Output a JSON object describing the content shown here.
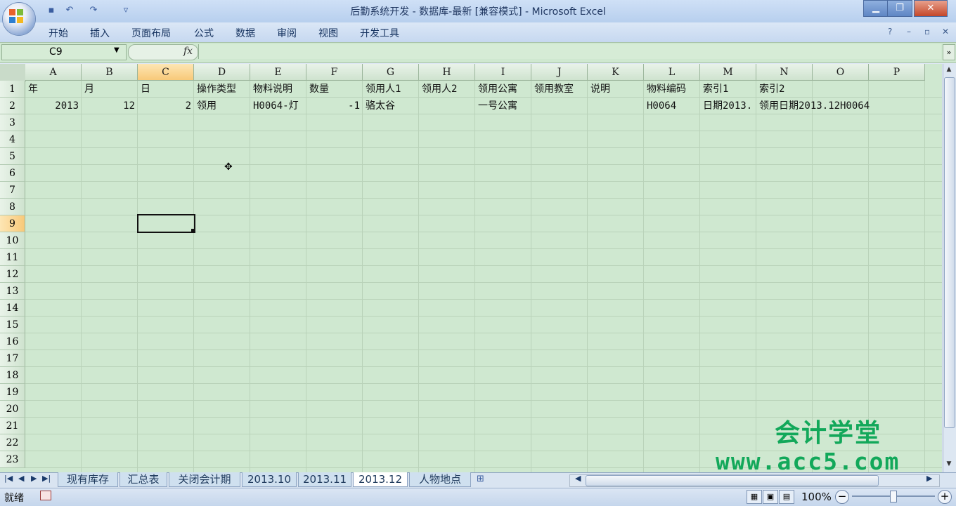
{
  "window": {
    "title": "后勤系统开发 - 数据库-最新  [兼容模式] - Microsoft Excel",
    "minimize": "▁",
    "maximize": "❐",
    "close": "✕"
  },
  "quick_access": [
    "save-icon",
    "undo-icon",
    "redo-icon",
    "customize-icon"
  ],
  "ribbon": {
    "tabs": [
      "开始",
      "插入",
      "页面布局",
      "公式",
      "数据",
      "审阅",
      "视图",
      "开发工具"
    ],
    "help": "?",
    "min": "–",
    "restore": "▫",
    "close": "✕"
  },
  "formula_bar": {
    "name_box": "C9",
    "fx": "fx",
    "value": ""
  },
  "grid": {
    "columns": [
      "A",
      "B",
      "C",
      "D",
      "E",
      "F",
      "G",
      "H",
      "I",
      "J",
      "K",
      "L",
      "M",
      "N",
      "O",
      "P"
    ],
    "selected_column": "C",
    "rows": [
      "1",
      "2",
      "3",
      "4",
      "5",
      "6",
      "7",
      "8",
      "9",
      "10",
      "11",
      "12",
      "13",
      "14",
      "15",
      "16",
      "17",
      "18",
      "19",
      "20",
      "21",
      "22",
      "23"
    ],
    "selected_row": "9",
    "row1": [
      "年",
      "月",
      "日",
      "操作类型",
      "物料说明",
      "数量",
      "领用人1",
      "领用人2",
      "领用公寓",
      "领用教室",
      "说明",
      "物料编码",
      "索引1",
      "索引2"
    ],
    "row2": {
      "A": "2013",
      "B": "12",
      "C": "2",
      "D": "领用",
      "E": "H0064-灯",
      "F": "-1",
      "G": "骆太谷",
      "I": "一号公寓",
      "L": "H0064",
      "M": "日期2013.",
      "N": "领用日期2013.12H0064"
    }
  },
  "sheets": {
    "tabs": [
      "现有库存",
      "汇总表",
      "关闭会计期",
      "2013.10",
      "2013.11",
      "2013.12",
      "人物地点"
    ],
    "active": "2013.12"
  },
  "status": {
    "ready": "就绪",
    "zoom": "100%"
  },
  "watermark": {
    "line1": "会计学堂",
    "line2": "www.acc5.com"
  },
  "colors": {
    "grid_bg": "#cfe8d0",
    "selected_header": "#f8c979",
    "watermark": "#12a85a"
  }
}
